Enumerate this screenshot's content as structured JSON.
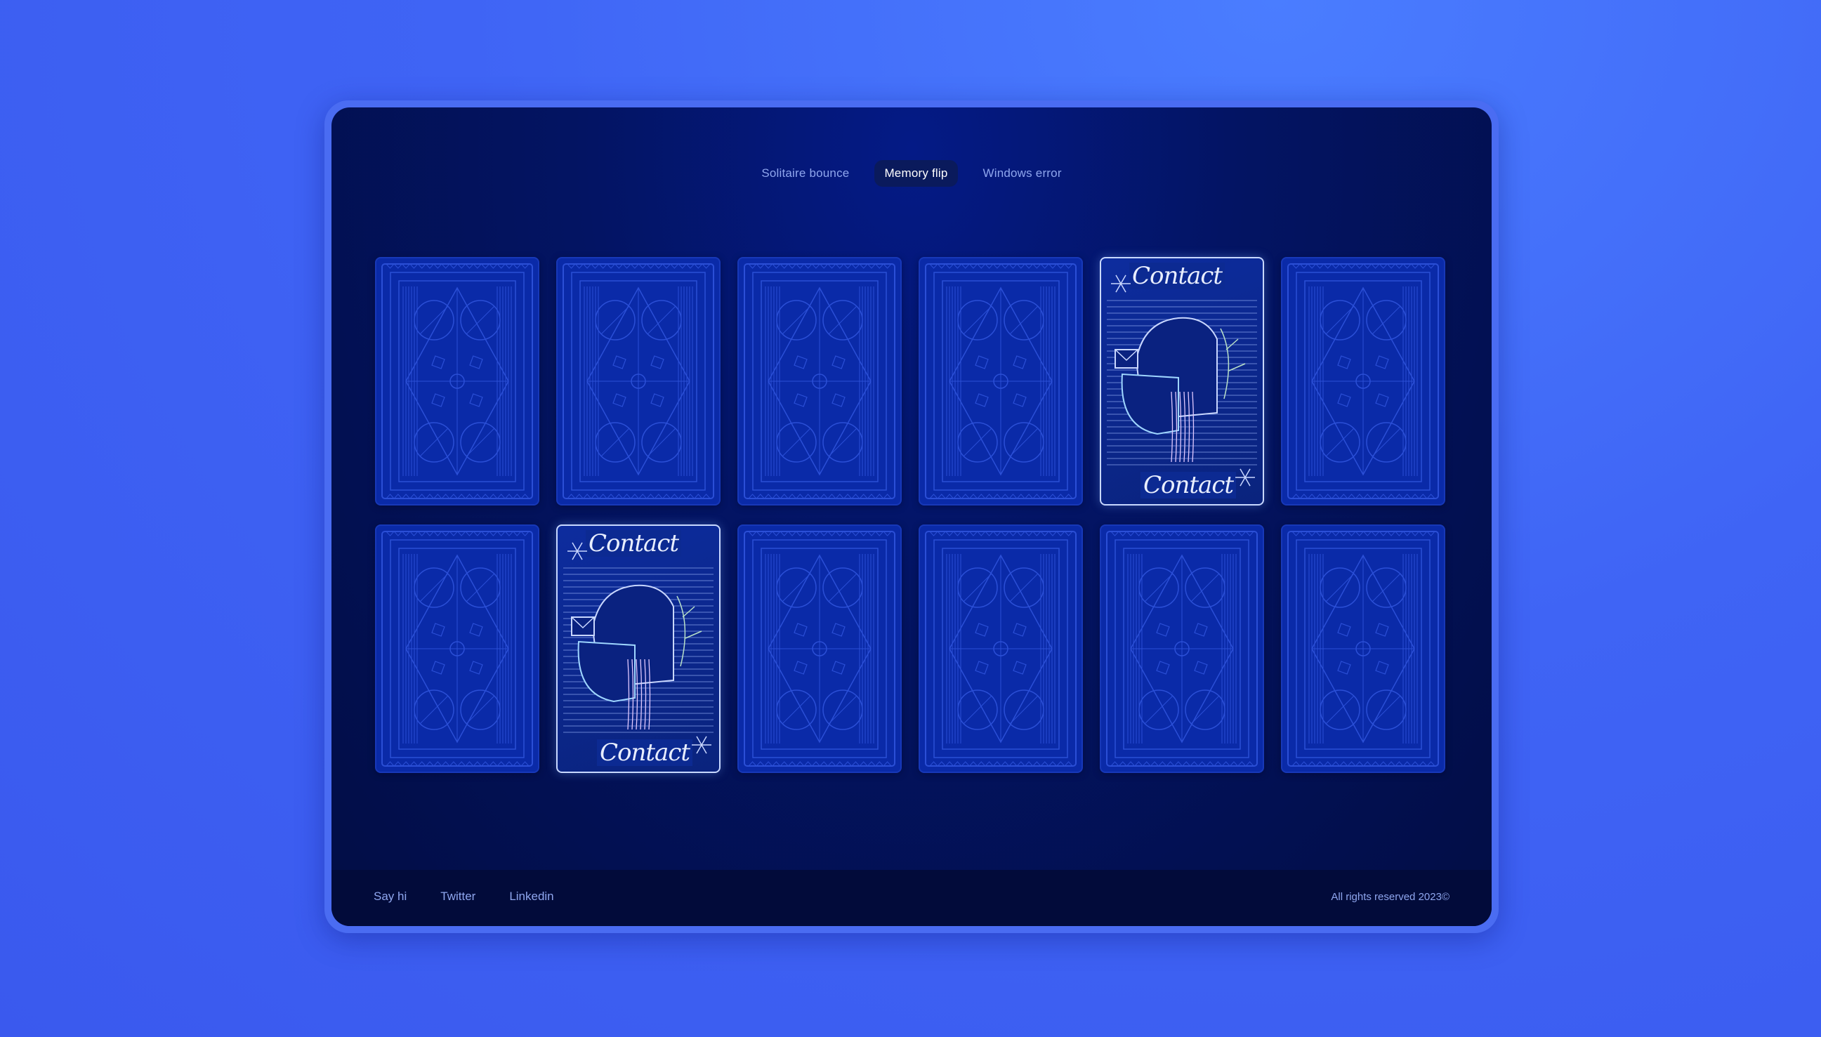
{
  "nav": {
    "tabs": [
      {
        "label": "Solitaire bounce",
        "active": false
      },
      {
        "label": "Memory flip",
        "active": true
      },
      {
        "label": "Windows error",
        "active": false
      }
    ]
  },
  "board": {
    "face_word": "Contact",
    "cards": [
      {
        "state": "back"
      },
      {
        "state": "back"
      },
      {
        "state": "back"
      },
      {
        "state": "back"
      },
      {
        "state": "face",
        "label": "Contact"
      },
      {
        "state": "back"
      },
      {
        "state": "back"
      },
      {
        "state": "face",
        "label": "Contact"
      },
      {
        "state": "back"
      },
      {
        "state": "back"
      },
      {
        "state": "back"
      },
      {
        "state": "back"
      }
    ]
  },
  "footer": {
    "links": [
      "Say hi",
      "Twitter",
      "Linkedin"
    ],
    "copyright": "All rights reserved 2023©"
  },
  "colors": {
    "background": "#3f64f5",
    "frame": "#4a6cf2",
    "screen": "#031463",
    "card_back": "#0a2aa8",
    "card_face_border": "#c8d8ff",
    "muted_text": "#8fa6ee"
  }
}
